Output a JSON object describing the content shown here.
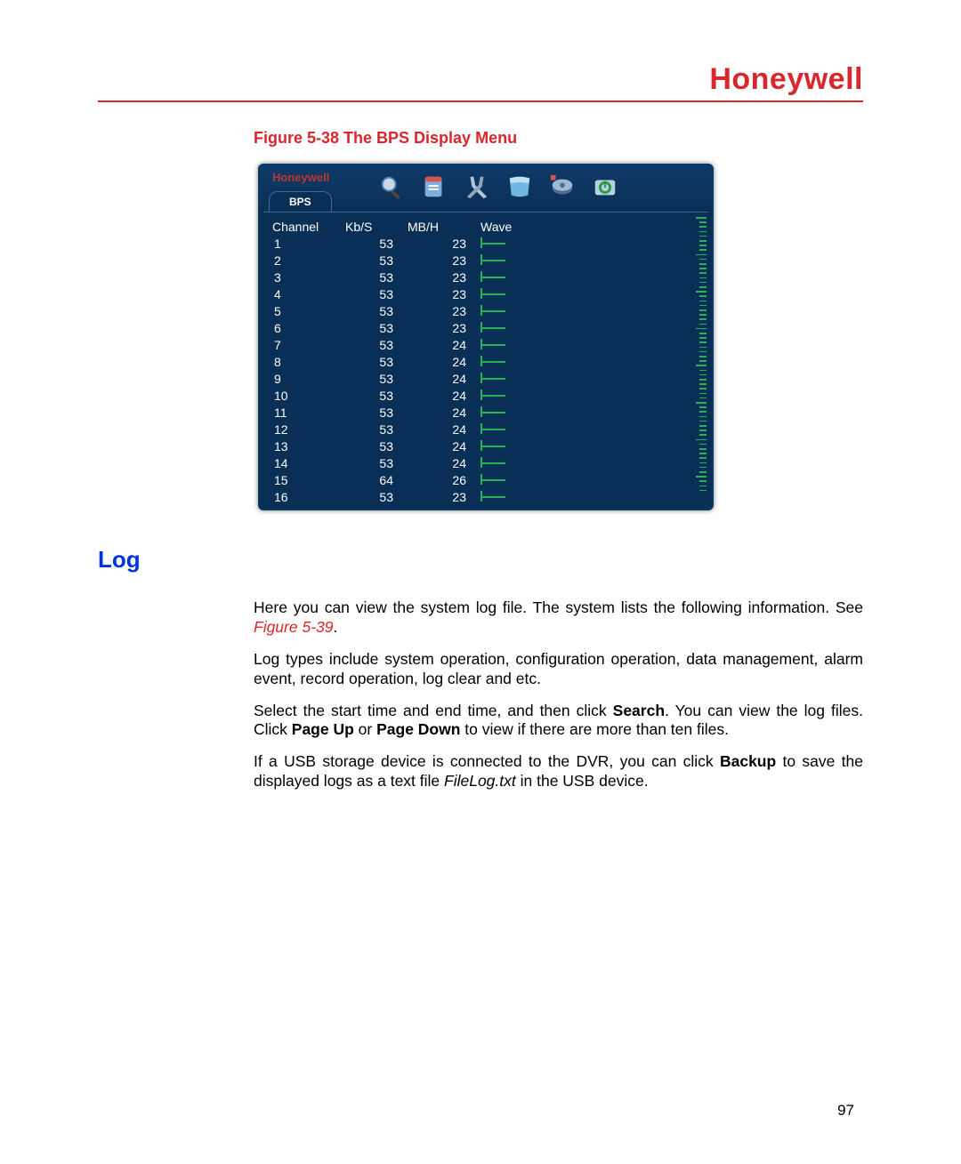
{
  "header": {
    "logo": "Honeywell"
  },
  "figure": {
    "caption": "Figure 5-38 The BPS Display Menu",
    "brand": "Honeywell",
    "tab": "BPS",
    "columns": {
      "ch": "Channel",
      "kbs": "Kb/S",
      "mbh": "MB/H",
      "wave": "Wave"
    },
    "rows": [
      {
        "ch": "1",
        "kbs": "53",
        "mbh": "23"
      },
      {
        "ch": "2",
        "kbs": "53",
        "mbh": "23"
      },
      {
        "ch": "3",
        "kbs": "53",
        "mbh": "23"
      },
      {
        "ch": "4",
        "kbs": "53",
        "mbh": "23"
      },
      {
        "ch": "5",
        "kbs": "53",
        "mbh": "23"
      },
      {
        "ch": "6",
        "kbs": "53",
        "mbh": "23"
      },
      {
        "ch": "7",
        "kbs": "53",
        "mbh": "24"
      },
      {
        "ch": "8",
        "kbs": "53",
        "mbh": "24"
      },
      {
        "ch": "9",
        "kbs": "53",
        "mbh": "24"
      },
      {
        "ch": "10",
        "kbs": "53",
        "mbh": "24"
      },
      {
        "ch": "11",
        "kbs": "53",
        "mbh": "24"
      },
      {
        "ch": "12",
        "kbs": "53",
        "mbh": "24"
      },
      {
        "ch": "13",
        "kbs": "53",
        "mbh": "24"
      },
      {
        "ch": "14",
        "kbs": "53",
        "mbh": "24"
      },
      {
        "ch": "15",
        "kbs": "64",
        "mbh": "26"
      },
      {
        "ch": "16",
        "kbs": "53",
        "mbh": "23"
      }
    ],
    "icons": [
      "search-icon",
      "log-icon",
      "tools-icon",
      "network-icon",
      "storage-icon",
      "shutdown-icon"
    ]
  },
  "section": {
    "title": "Log"
  },
  "text": {
    "p1a": "Here you can view the system log file. The system lists the following information. See ",
    "p1ref": "Figure 5-39",
    "p1dot": ".",
    "p2": "Log types include system operation, configuration operation, data management, alarm event, record operation, log clear and etc.",
    "p3a": "Select the start time and end time, and then click ",
    "p3b": "Search",
    "p3c": ". You can view the log files. Click ",
    "p3d": "Page Up",
    "p3e": " or ",
    "p3f": "Page Down",
    "p3g": " to view if there are more than ten files.",
    "p4a": "If a USB storage device is connected to the DVR, you can click ",
    "p4b": "Backup",
    "p4c": " to save the displayed logs as a text file ",
    "p4file": "FileLog.txt",
    "p4d": " in the USB device."
  },
  "page_number": "97"
}
